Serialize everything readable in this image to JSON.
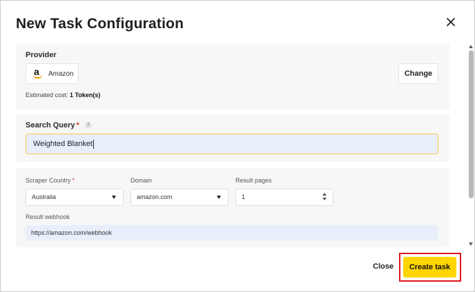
{
  "dialog": {
    "title": "New Task Configuration"
  },
  "provider": {
    "label": "Provider",
    "name": "Amazon",
    "change_label": "Change",
    "est_cost_prefix": "Estimated cost:",
    "est_cost_value": "1 Token(s)"
  },
  "query": {
    "label": "Search Query",
    "required_mark": "*",
    "help_glyph": "?",
    "value": "Weighted Blanket"
  },
  "config": {
    "country": {
      "label": "Scraper Country",
      "required_mark": "*",
      "value": "Australia"
    },
    "domain": {
      "label": "Domain",
      "value": "amazon.com"
    },
    "pages": {
      "label": "Result pages",
      "value": "1"
    },
    "webhook": {
      "label": "Result webhook",
      "value": "https://amazon.com/webhook"
    }
  },
  "footer": {
    "close_label": "Close",
    "create_label": "Create task"
  },
  "colors": {
    "accent": "#ffd600",
    "highlight_frame": "#e0141e",
    "input_bg": "#e8effb",
    "focus_border": "#f2c94c",
    "section_bg": "#f7f7f7"
  },
  "icons": {
    "close": "close-icon",
    "provider_logo": "amazon-logo-icon",
    "help": "help-icon",
    "dropdown": "chevron-down-icon",
    "stepper": "stepper-icon"
  }
}
